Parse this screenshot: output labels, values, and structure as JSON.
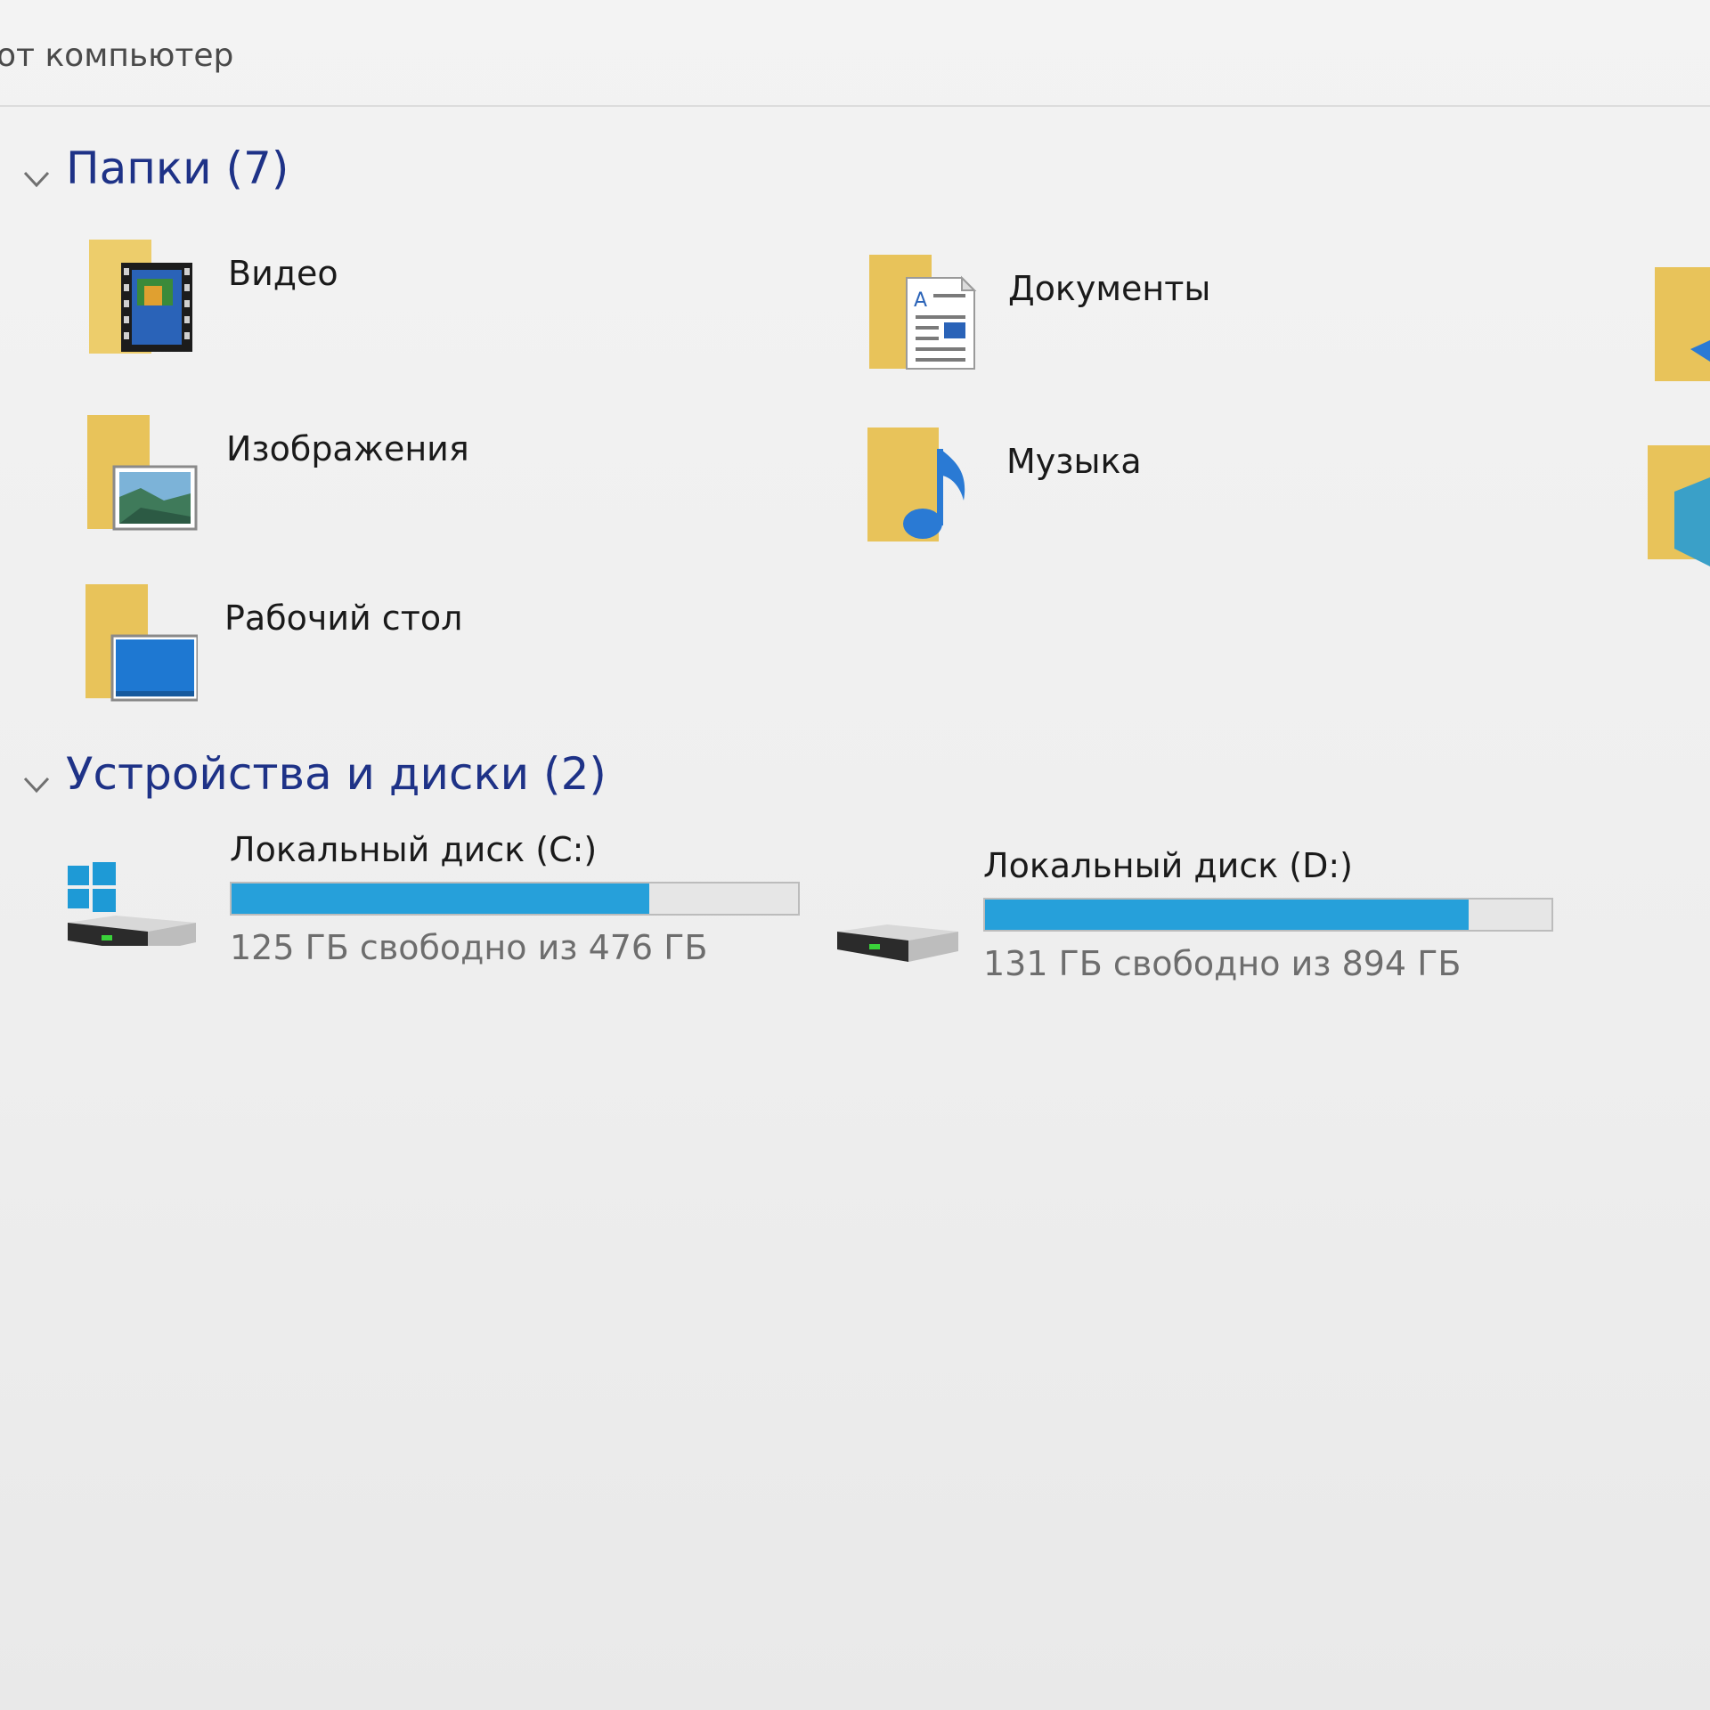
{
  "breadcrumb": {
    "text": "от компьютер"
  },
  "folders_section": {
    "title": "Папки (7)",
    "items": [
      {
        "label": "Видео",
        "icon": "video-folder-icon"
      },
      {
        "label": "Документы",
        "icon": "documents-folder-icon"
      },
      {
        "label": "Изображения",
        "icon": "pictures-folder-icon"
      },
      {
        "label": "Музыка",
        "icon": "music-folder-icon"
      },
      {
        "label": "Рабочий стол",
        "icon": "desktop-folder-icon"
      }
    ]
  },
  "devices_section": {
    "title": "Устройства и диски (2)",
    "drives": [
      {
        "name": "Локальный диск (C:)",
        "free_text": "125 ГБ свободно из 476 ГБ",
        "used_fraction": 0.737,
        "icon": "windows-drive-icon"
      },
      {
        "name": "Локальный диск (D:)",
        "free_text": "131 ГБ свободно из 894 ГБ",
        "used_fraction": 0.853,
        "icon": "hard-drive-icon"
      }
    ]
  },
  "colors": {
    "accent": "#26a0da",
    "section_title": "#1e3287",
    "folder": "#e8c35a"
  }
}
